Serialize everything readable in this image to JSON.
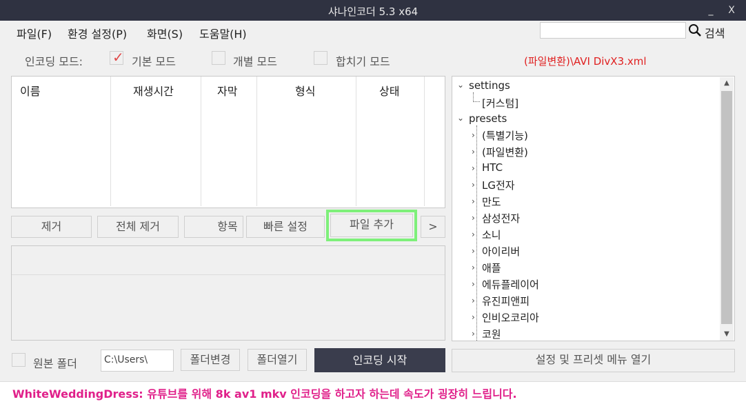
{
  "window": {
    "title": "샤나인코더  5.3  x64",
    "minimize": "_",
    "close": "X"
  },
  "menu": {
    "file": "파일(F)",
    "settings": "환경 설정(P)",
    "screen": "화면(S)",
    "help": "도움말(H)"
  },
  "search": {
    "placeholder": "",
    "label": "검색"
  },
  "encoding_mode": {
    "label": "인코딩 모드:",
    "basic": "기본 모드",
    "individual": "개별 모드",
    "merge": "합치기 모드",
    "basic_checked": true
  },
  "preset_path": "(파일변환)\\AVI DivX3.xml",
  "file_table": {
    "columns": [
      "이름",
      "재생시간",
      "자막",
      "형식",
      "상태"
    ]
  },
  "buttons": {
    "remove": "제거",
    "remove_all": "전체 제거",
    "items": "항목",
    "quick_settings": "빠른 설정",
    "add_file": "파일 추가",
    "more": ">",
    "change_folder": "폴더변경",
    "open_folder": "폴더열기",
    "start_encoding": "인코딩 시작",
    "open_settings_menu": "설정 및 프리셋 메뉴 열기"
  },
  "output": {
    "source_folder_label": "원본 폴더",
    "path": "C:\\Users\\"
  },
  "tree": {
    "settings": "settings",
    "custom": "[커스텀]",
    "presets": "presets",
    "children": [
      "(특별기능)",
      "(파일변환)",
      "HTC",
      "LG전자",
      "만도",
      "삼성전자",
      "소니",
      "아이리버",
      "애플",
      "에듀플레이어",
      "유진피앤피",
      "인비오코리아",
      "코원"
    ]
  },
  "status_message": "WhiteWeddingDress: 유튜브를 위해 8k av1 mkv 인코딩을 하고자 하는데 속도가 굉장히 느립니다.",
  "colors": {
    "titlebar": "#2f3241",
    "highlight": "#7ef07a",
    "preset_path": "#e02020",
    "status": "#e0208a"
  }
}
